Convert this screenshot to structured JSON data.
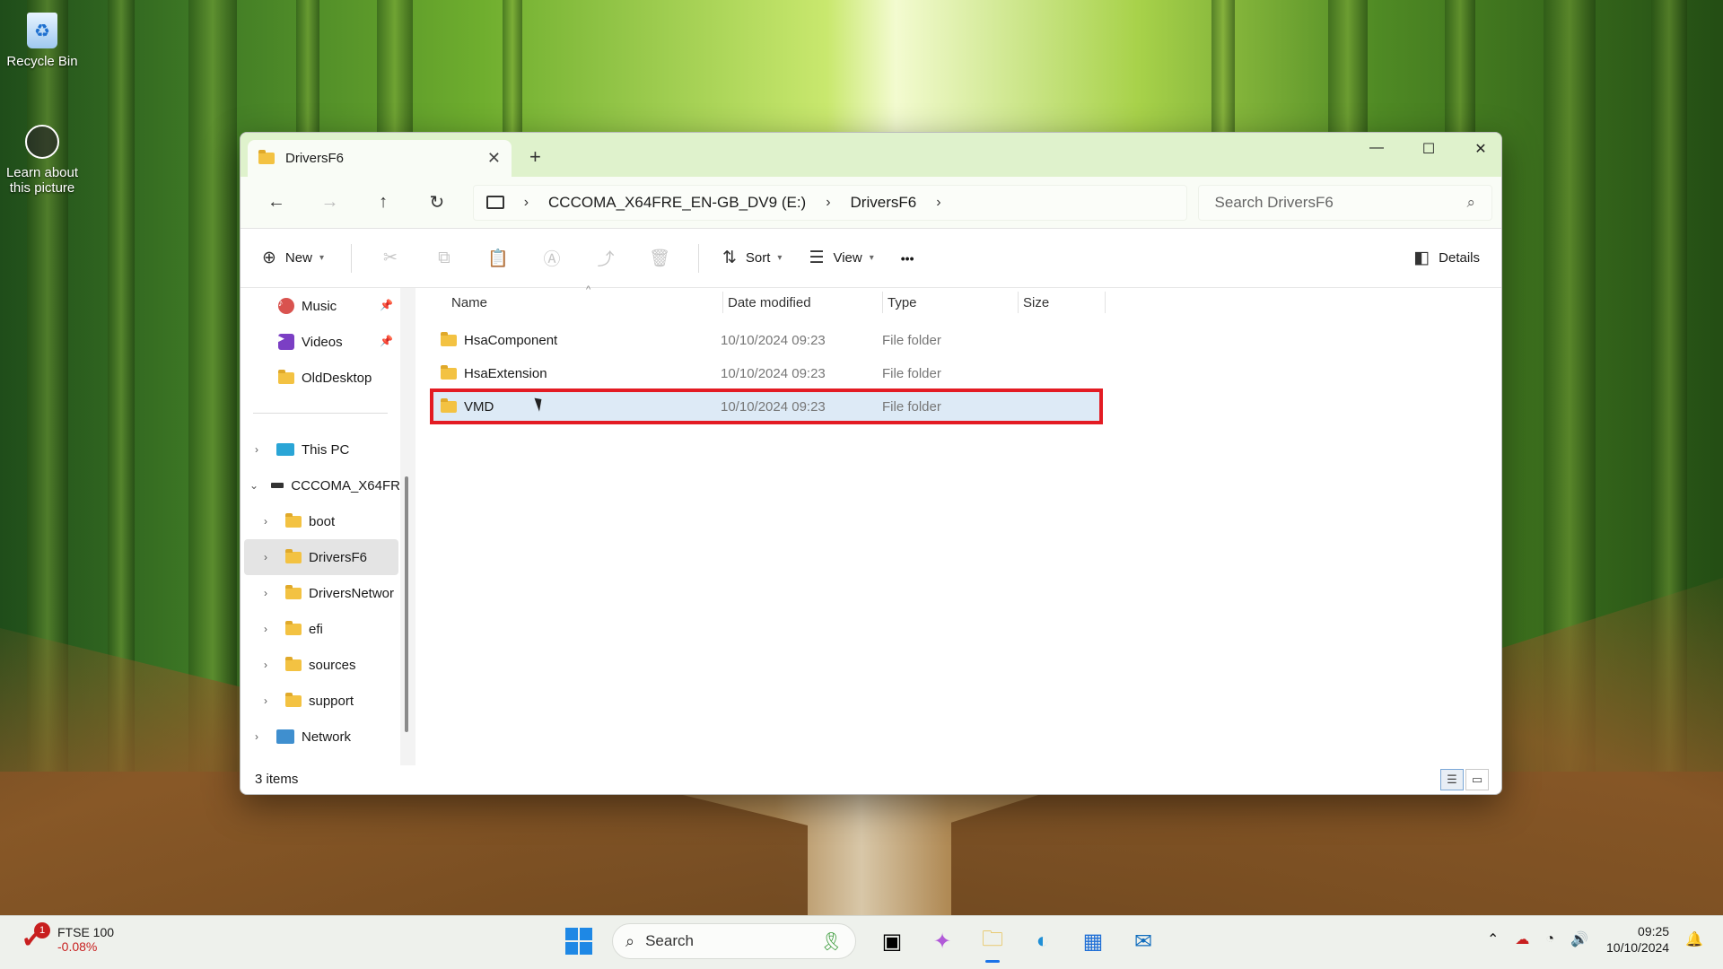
{
  "desktop": {
    "icons": [
      {
        "label": "Recycle Bin"
      },
      {
        "label": "Learn about this picture"
      }
    ]
  },
  "window": {
    "tab_title": "DriversF6",
    "tab_close": "✕",
    "new_tab": "+",
    "controls": {
      "minimize": "—",
      "maximize": "☐",
      "close": "✕"
    }
  },
  "navbar": {
    "back": "←",
    "forward": "→",
    "up": "↑",
    "refresh": "↻",
    "breadcrumb": [
      "CCCOMA_X64FRE_EN-GB_DV9 (E:)",
      "DriversF6"
    ],
    "separator": "›",
    "search_placeholder": "Search DriversF6",
    "search_icon": "⌕"
  },
  "toolbar": {
    "new_label": "New",
    "sort_label": "Sort",
    "view_label": "View",
    "more": "•••",
    "details_label": "Details"
  },
  "nav_pane": {
    "quick": [
      {
        "label": "Music",
        "icon": "music-icon"
      },
      {
        "label": "Videos",
        "icon": "video-icon"
      },
      {
        "label": "OldDesktop",
        "icon": "folder-icon"
      }
    ],
    "this_pc": "This PC",
    "drive": "CCCOMA_X64FR",
    "folders": [
      "boot",
      "DriversF6",
      "DriversNetwor",
      "efi",
      "sources",
      "support"
    ],
    "network": "Network"
  },
  "columns": {
    "name": "Name",
    "date": "Date modified",
    "type": "Type",
    "size": "Size"
  },
  "files": [
    {
      "name": "HsaComponent",
      "date": "10/10/2024 09:23",
      "type": "File folder"
    },
    {
      "name": "HsaExtension",
      "date": "10/10/2024 09:23",
      "type": "File folder"
    },
    {
      "name": "VMD",
      "date": "10/10/2024 09:23",
      "type": "File folder"
    }
  ],
  "status": {
    "items": "3 items"
  },
  "taskbar": {
    "stock_name": "FTSE 100",
    "stock_change": "-0.08%",
    "stock_badge": "1",
    "search_label": "Search",
    "time": "09:25",
    "date": "10/10/2024"
  },
  "colors": {
    "highlight_border": "#e31b23",
    "accent": "#1a73e8",
    "folder": "#f3c242"
  }
}
